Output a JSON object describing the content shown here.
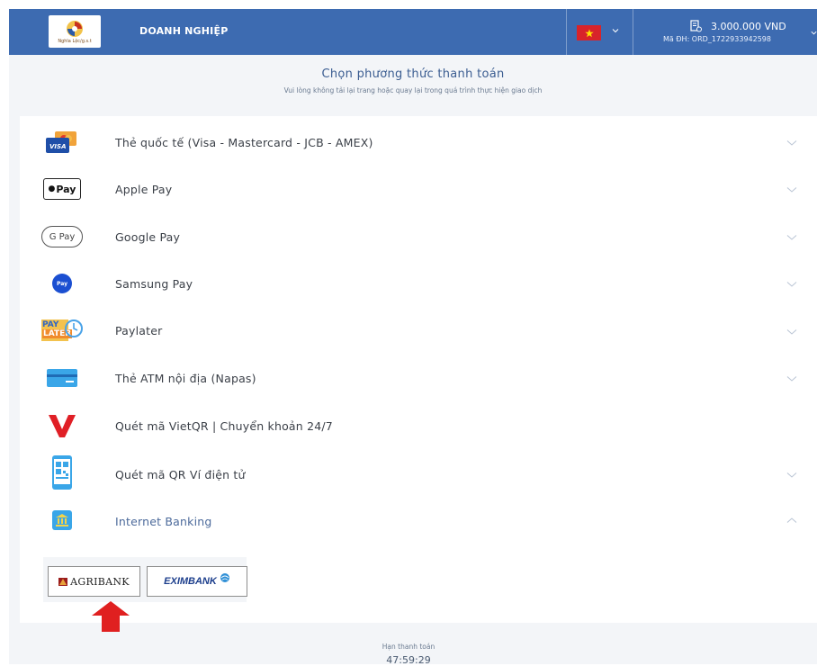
{
  "header": {
    "org_name": "DOANH NGHIỆP",
    "logo_text": "Nghĩa Lộc/g.s.t",
    "amount": "3.000.000 VND",
    "order_id": "Mã ĐH: ORD_1722933942598"
  },
  "page": {
    "title": "Chọn phương thức thanh toán",
    "subtitle": "Vui lòng không tải lại trang hoặc quay lại trong quá trình thực hiện giao dịch"
  },
  "methods": [
    {
      "label": "Thẻ quốc tế (Visa - Mastercard - JCB - AMEX)",
      "icon": "visa-card-icon",
      "expanded": false
    },
    {
      "label": "Apple Pay",
      "icon": "apple-pay-icon",
      "icon_text": "Pay",
      "expanded": false
    },
    {
      "label": "Google Pay",
      "icon": "google-pay-icon",
      "icon_text": "G Pay",
      "expanded": false
    },
    {
      "label": "Samsung Pay",
      "icon": "samsung-pay-icon",
      "icon_text": "Pay",
      "expanded": false
    },
    {
      "label": "Paylater",
      "icon": "paylater-icon",
      "icon_text_top": "PAY",
      "icon_text_bottom": "LATER",
      "expanded": false
    },
    {
      "label": "Thẻ ATM nội địa (Napas)",
      "icon": "atm-card-icon",
      "expanded": false
    },
    {
      "label": "Quét mã VietQR | Chuyển khoản 24/7",
      "icon": "vietqr-icon",
      "expanded": false
    },
    {
      "label": "Quét mã QR Ví điện tử",
      "icon": "qr-wallet-icon",
      "expanded": false
    },
    {
      "label": "Internet Banking",
      "icon": "bank-icon",
      "expanded": true
    }
  ],
  "banks": [
    {
      "name": "AGRIBANK"
    },
    {
      "name": "EXIMBANK"
    }
  ],
  "footer": {
    "deadline_label": "Hạn thanh toán",
    "countdown": "47:59:29"
  },
  "colors": {
    "header_bg": "#3d6bb1",
    "accent_text": "#3b5d91",
    "highlight_arrow": "#e02020"
  }
}
